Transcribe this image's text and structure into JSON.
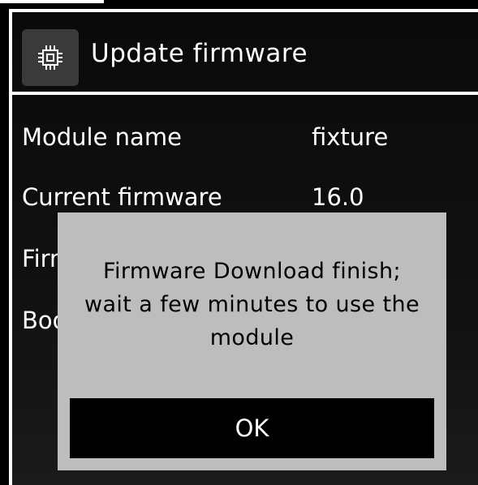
{
  "header": {
    "icon": "chip-icon",
    "title": "Update firmware"
  },
  "rows": [
    {
      "label": "Module name",
      "value": "fixture"
    },
    {
      "label": "Current firmware",
      "value": "16.0"
    },
    {
      "label": "Firmware",
      "value": ""
    },
    {
      "label": "Bootloader",
      "value": ""
    }
  ],
  "dialog": {
    "message_line1": "Firmware Download finish;",
    "message_line2": "wait a few minutes to use the",
    "message_line3": "module",
    "ok_label": "OK"
  },
  "colors": {
    "background": "#000000",
    "dialog_background": "#bdbdbd",
    "icon_tile": "#3a3a3a",
    "text": "#ffffff"
  }
}
